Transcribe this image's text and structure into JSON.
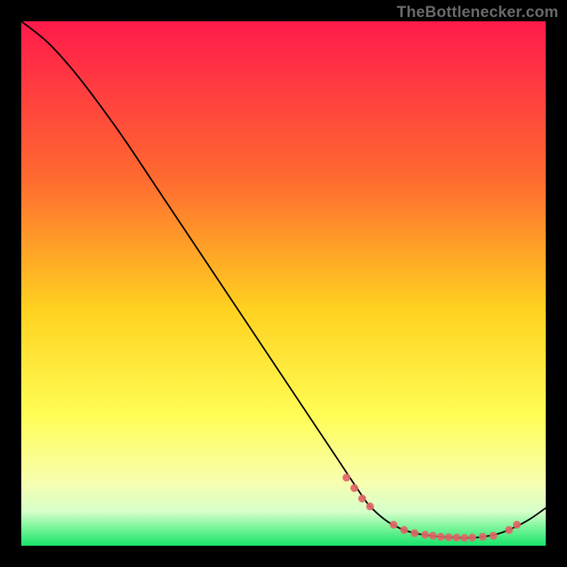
{
  "watermark": "TheBottlenecker.com",
  "chart_data": {
    "type": "line",
    "title": "",
    "xlabel": "",
    "ylabel": "",
    "xlim": [
      0,
      100
    ],
    "ylim": [
      0,
      100
    ],
    "grid": false,
    "legend": false,
    "background_gradient": {
      "stops": [
        {
          "offset": 0.0,
          "color": "#ff1a4b"
        },
        {
          "offset": 0.3,
          "color": "#ff6a30"
        },
        {
          "offset": 0.55,
          "color": "#ffd21f"
        },
        {
          "offset": 0.75,
          "color": "#fffd55"
        },
        {
          "offset": 0.88,
          "color": "#f7ffb0"
        },
        {
          "offset": 0.935,
          "color": "#d6ffca"
        },
        {
          "offset": 0.965,
          "color": "#7cf59a"
        },
        {
          "offset": 1.0,
          "color": "#17e36a"
        }
      ]
    },
    "series": [
      {
        "name": "bottleneck-curve",
        "color": "#000000",
        "x": [
          0,
          5,
          10,
          15,
          20,
          25,
          30,
          35,
          40,
          45,
          50,
          55,
          60,
          65,
          67,
          70,
          73,
          76,
          79,
          82,
          85,
          88,
          91,
          94,
          97,
          100
        ],
        "y": [
          100,
          96,
          90.5,
          84,
          77,
          69.5,
          62,
          54.5,
          47,
          39.5,
          32,
          24.5,
          17,
          9.5,
          7,
          4.5,
          3,
          2.2,
          1.8,
          1.6,
          1.5,
          1.7,
          2.3,
          3.5,
          5.1,
          7.2
        ]
      }
    ],
    "markers": {
      "name": "sample-points",
      "color": "#e06666",
      "radius": 5.5,
      "x": [
        62,
        63.5,
        65,
        66.5,
        71,
        73,
        75,
        77,
        78.5,
        80,
        81.5,
        83,
        84.5,
        86,
        88,
        90,
        93,
        94.5
      ],
      "y": [
        13,
        11,
        9,
        7.5,
        4,
        3,
        2.4,
        2.1,
        1.9,
        1.7,
        1.6,
        1.55,
        1.5,
        1.55,
        1.7,
        1.9,
        3,
        4
      ]
    }
  }
}
